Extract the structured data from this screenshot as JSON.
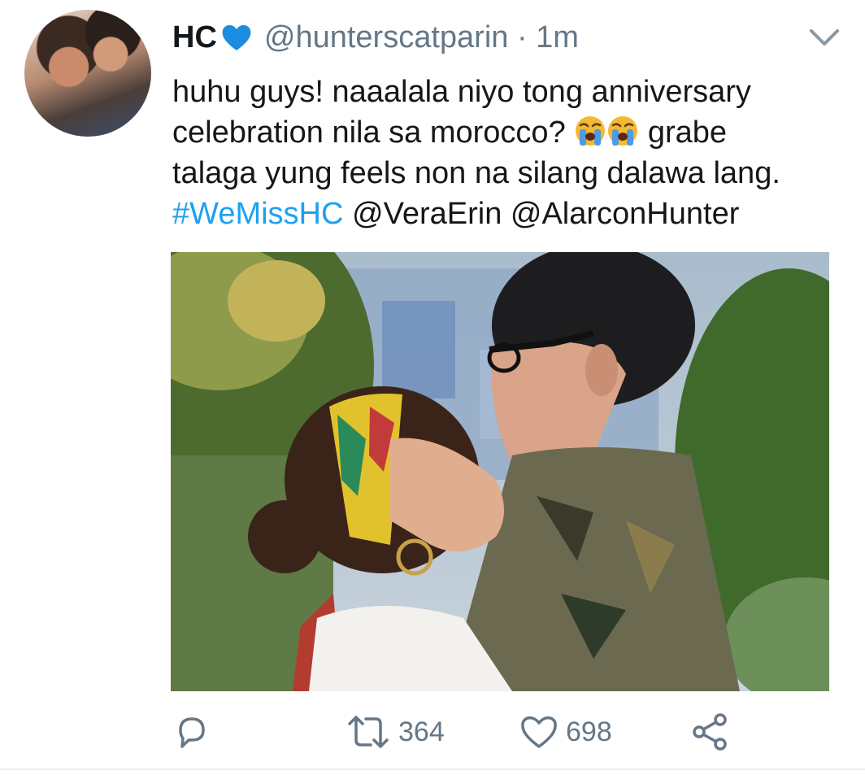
{
  "tweet": {
    "display_name": "HC",
    "name_emoji": "blue-heart",
    "handle_and_time": "@hunterscatparin · 1m",
    "lines": {
      "l1": "huhu guys! naaalala niyo tong anniversary",
      "l2_pre": "celebration nila sa morocco? ",
      "l2_post": " grabe",
      "l3": "talaga yung feels non na silang dalawa lang.",
      "hashtag": "#WeMissHC",
      "mention1": "@VeraErin",
      "mention2": "@AlarconHunter"
    },
    "emoji": "loudly-crying-face",
    "retweets": "364",
    "likes": "698"
  },
  "icons": {
    "menu": "chevron-down-icon",
    "reply": "reply-icon",
    "retweet": "retweet-icon",
    "like": "heart-icon",
    "share": "share-icon"
  },
  "colors": {
    "link": "#1da1f2",
    "secondary": "#657786",
    "heart_blue": "#1da1f2"
  }
}
